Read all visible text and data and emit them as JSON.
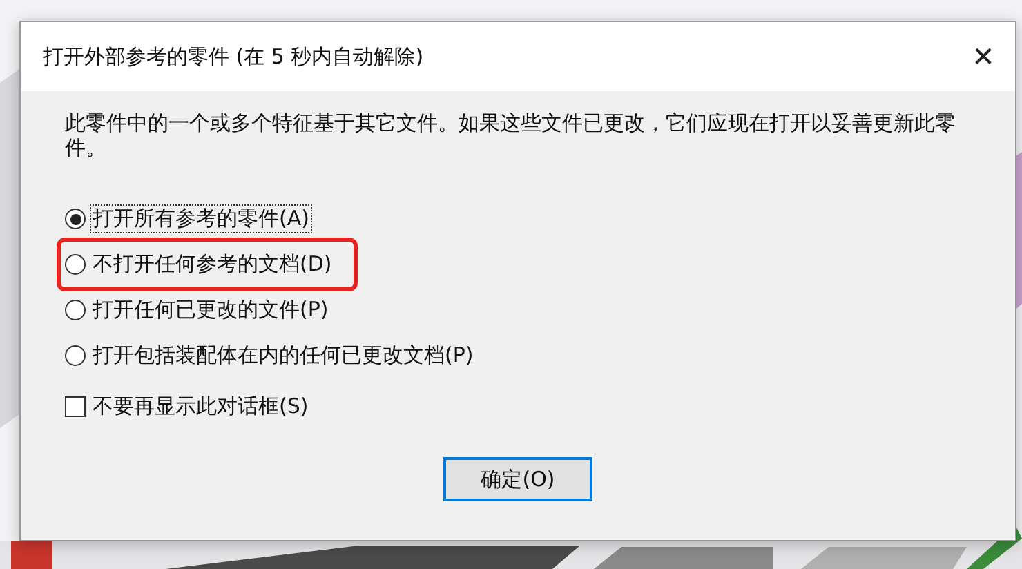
{
  "window": {
    "title": "打开外部参考的零件 (在 5 秒内自动解除)",
    "close": "✕"
  },
  "message": "此零件中的一个或多个特征基于其它文件。如果这些文件已更改，它们应现在打开以妥善更新此零件。",
  "options": [
    {
      "label": "打开所有参考的零件(A)",
      "selected": true,
      "annotated": false
    },
    {
      "label": "不打开任何参考的文档(D)",
      "selected": false,
      "annotated": true
    },
    {
      "label": "打开任何已更改的文件(P)",
      "selected": false,
      "annotated": false
    },
    {
      "label": "打开包括装配体在内的任何已更改文档(P)",
      "selected": false,
      "annotated": false
    }
  ],
  "dont_show": {
    "label": "不要再显示此对话框(S)",
    "checked": false
  },
  "buttons": [
    "确定(O)"
  ]
}
